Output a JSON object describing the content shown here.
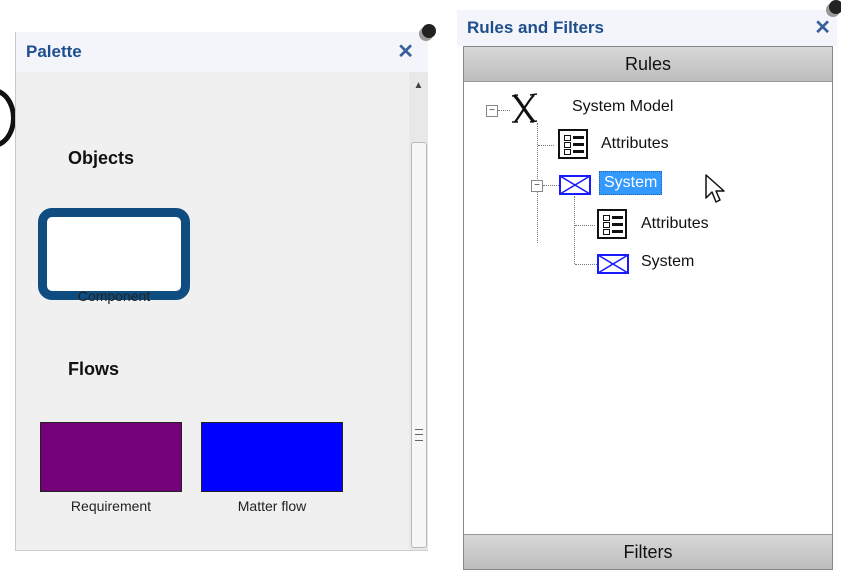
{
  "palette": {
    "title": "Palette",
    "close": "✕",
    "groups": {
      "objects": {
        "title": "Objects",
        "items": [
          {
            "label": "Component",
            "icon": "component-shape-icon"
          }
        ]
      },
      "flows": {
        "title": "Flows",
        "items": [
          {
            "label": "Requirement",
            "color": "#74007a"
          },
          {
            "label": "Matter flow",
            "color": "#0000ff"
          }
        ]
      }
    },
    "scroll_up": "▲"
  },
  "rules_panel": {
    "title": "Rules and Filters",
    "close": "✕",
    "rules_bar": "Rules",
    "filters_bar": "Filters",
    "tree": {
      "root": {
        "label": "System Model",
        "icon": "system-model-x-icon",
        "toggle": "−"
      },
      "children": [
        {
          "label": "Attributes",
          "icon": "attributes-icon"
        },
        {
          "label": "System",
          "icon": "system-envelope-icon",
          "selected": true,
          "toggle": "−",
          "children": [
            {
              "label": "Attributes",
              "icon": "attributes-icon"
            },
            {
              "label": "System",
              "icon": "system-envelope-icon"
            }
          ]
        }
      ]
    },
    "colors": {
      "selection": "#3399ff",
      "header_text": "#1f4e8c",
      "system_icon": "#1a1aff"
    }
  }
}
